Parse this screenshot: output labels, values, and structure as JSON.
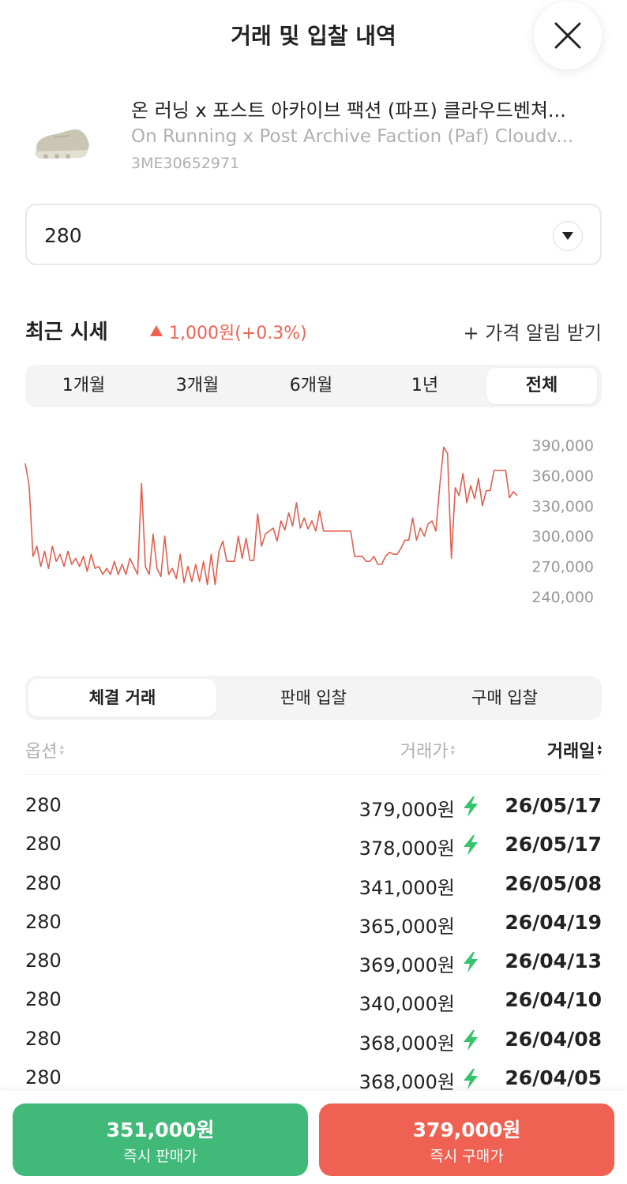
{
  "header": {
    "title": "거래 및 입찰 내역"
  },
  "product": {
    "name_ko": "온 러닝 x 포스트 아카이브 팩션 (파프) 클라우드벤쳐...",
    "name_en": "On Running x Post Archive Faction (Paf) Cloudv...",
    "code": "3ME30652971"
  },
  "size_select": {
    "value": "280"
  },
  "market": {
    "label": "최근 시세",
    "change": "1,000원(+0.3%)",
    "alert": "+ 가격 알림 받기",
    "change_color": "#ef6253"
  },
  "period_tabs": [
    {
      "label": "1개월",
      "active": false
    },
    {
      "label": "3개월",
      "active": false
    },
    {
      "label": "6개월",
      "active": false
    },
    {
      "label": "1년",
      "active": false
    },
    {
      "label": "전체",
      "active": true
    }
  ],
  "chart_data": {
    "type": "line",
    "y_ticks": [
      "390,000",
      "360,000",
      "330,000",
      "300,000",
      "270,000",
      "240,000"
    ],
    "ylim": [
      240000,
      390000
    ],
    "color": "#e0604f",
    "values": [
      372000,
      350000,
      280000,
      290000,
      270000,
      285000,
      268000,
      290000,
      275000,
      282000,
      270000,
      285000,
      272000,
      278000,
      270000,
      280000,
      265000,
      282000,
      268000,
      270000,
      262000,
      268000,
      262000,
      275000,
      262000,
      272000,
      262000,
      278000,
      270000,
      262000,
      352000,
      270000,
      262000,
      302000,
      268000,
      260000,
      300000,
      262000,
      268000,
      258000,
      282000,
      254000,
      270000,
      255000,
      272000,
      255000,
      275000,
      252000,
      282000,
      252000,
      285000,
      295000,
      275000,
      275000,
      275000,
      300000,
      278000,
      298000,
      276000,
      276000,
      322000,
      290000,
      302000,
      305000,
      308000,
      295000,
      315000,
      306000,
      323000,
      310000,
      333000,
      308000,
      318000,
      307000,
      315000,
      305000,
      325000,
      305000,
      305000,
      305000,
      305000,
      305000,
      305000,
      305000,
      305000,
      280000,
      280000,
      280000,
      275000,
      275000,
      280000,
      272000,
      272000,
      280000,
      284000,
      282000,
      282000,
      288000,
      296000,
      296000,
      318000,
      296000,
      308000,
      300000,
      312000,
      315000,
      305000,
      350000,
      388000,
      382000,
      278000,
      348000,
      340000,
      362000,
      333000,
      350000,
      337000,
      357000,
      330000,
      345000,
      345000,
      365000,
      365000,
      365000,
      365000,
      338000,
      344000,
      340000
    ]
  },
  "trade_tabs": [
    {
      "label": "체결 거래",
      "active": true
    },
    {
      "label": "판매 입찰",
      "active": false
    },
    {
      "label": "구매 입찰",
      "active": false
    }
  ],
  "table": {
    "headers": {
      "option": "옵션",
      "price": "거래가",
      "date": "거래일"
    },
    "rows": [
      {
        "option": "280",
        "price": "379,000원",
        "express": true,
        "date": "26/05/17"
      },
      {
        "option": "280",
        "price": "378,000원",
        "express": true,
        "date": "26/05/17"
      },
      {
        "option": "280",
        "price": "341,000원",
        "express": false,
        "date": "26/05/08"
      },
      {
        "option": "280",
        "price": "365,000원",
        "express": false,
        "date": "26/04/19"
      },
      {
        "option": "280",
        "price": "369,000원",
        "express": true,
        "date": "26/04/13"
      },
      {
        "option": "280",
        "price": "340,000원",
        "express": false,
        "date": "26/04/10"
      },
      {
        "option": "280",
        "price": "368,000원",
        "express": true,
        "date": "26/04/08"
      },
      {
        "option": "280",
        "price": "368,000원",
        "express": true,
        "date": "26/04/05"
      }
    ]
  },
  "actions": {
    "sell": {
      "amount": "351,000원",
      "label": "즉시 판매가",
      "color": "#41b979"
    },
    "buy": {
      "amount": "379,000원",
      "label": "즉시 구매가",
      "color": "#ef6253"
    }
  }
}
